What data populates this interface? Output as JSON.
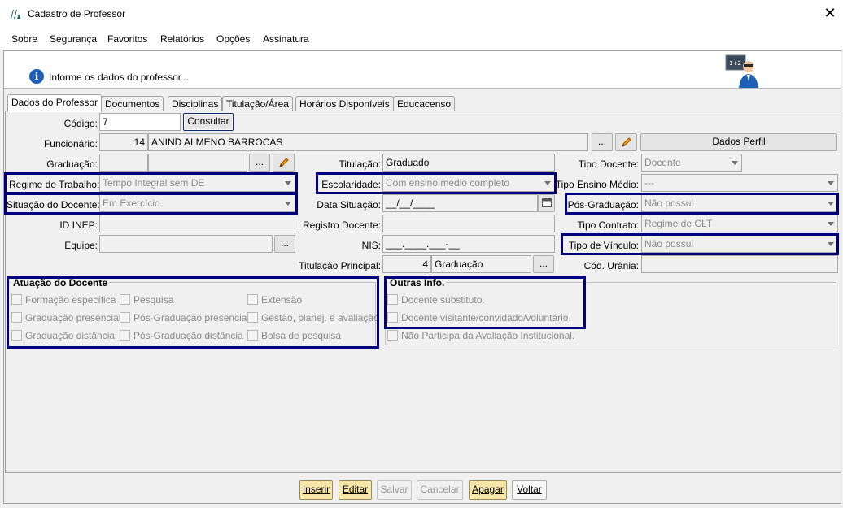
{
  "window": {
    "title": "Cadastro de Professor"
  },
  "menu": [
    "Sobre",
    "Segurança",
    "Favoritos",
    "Relatórios",
    "Opções",
    "Assinatura"
  ],
  "header": {
    "info": "Informe os dados do professor..."
  },
  "tabs": [
    "Dados do Professor",
    "Documentos",
    "Disciplinas",
    "Titulação/Área",
    "Horários Disponíveis",
    "Educacenso"
  ],
  "form": {
    "codigo_label": "Código:",
    "codigo_value": "7",
    "consultar": "Consultar",
    "funcionario_label": "Funcionário:",
    "funcionario_id": "14",
    "funcionario_nome": "ANIND ALMENO BARROCAS",
    "dots": "...",
    "dados_perfil": "Dados Perfil",
    "graduacao_label": "Graduação:",
    "titulacao_label": "Titulação:",
    "titulacao_value": "Graduado",
    "tipo_docente_label": "Tipo Docente:",
    "tipo_docente_value": "Docente",
    "regime_label": "Regime de Trabalho:",
    "regime_value": "Tempo Integral sem DE",
    "escolaridade_label": "Escolaridade:",
    "escolaridade_value": "Com ensino médio completo",
    "tipo_ensino_label": "Tipo Ensino Médio:",
    "tipo_ensino_value": "---",
    "situacao_label": "Situação do Docente:",
    "situacao_value": "Em Exercício",
    "data_situacao_label": "Data Situação:",
    "data_situacao_value": "__/__/____",
    "pos_grad_label": "Pós-Graduação:",
    "pos_grad_value": "Não possui",
    "id_inep_label": "ID INEP:",
    "registro_label": "Registro Docente:",
    "tipo_contrato_label": "Tipo Contrato:",
    "tipo_contrato_value": "Regime de CLT",
    "equipe_label": "Equipe:",
    "nis_label": "NIS:",
    "nis_value": "___.____.___-__",
    "tipo_vinculo_label": "Tipo de Vínculo:",
    "tipo_vinculo_value": "Não possui",
    "tit_principal_label": "Titulação Principal:",
    "tit_principal_num": "4",
    "tit_principal_value": "Graduação",
    "cod_urania_label": "Cód. Urânia:"
  },
  "atuacao": {
    "title": "Atuação do Docente",
    "items": [
      "Formação específica",
      "Pesquisa",
      "Extensão",
      "Graduação presencial",
      "Pós-Graduação presencial",
      "Gestão, planej. e avaliação",
      "Graduação distância",
      "Pós-Graduação distância",
      "Bolsa de pesquisa"
    ]
  },
  "outras": {
    "title": "Outras Info.",
    "items": [
      "Docente substituto.",
      "Docente visitante/convidado/voluntário.",
      "Não Participa da Avaliação Institucional."
    ]
  },
  "buttons": [
    "Inserir",
    "Editar",
    "Salvar",
    "Cancelar",
    "Apagar",
    "Voltar"
  ],
  "colors": {
    "highlight": "#00007f",
    "accent_button": "#f6e6a8"
  }
}
